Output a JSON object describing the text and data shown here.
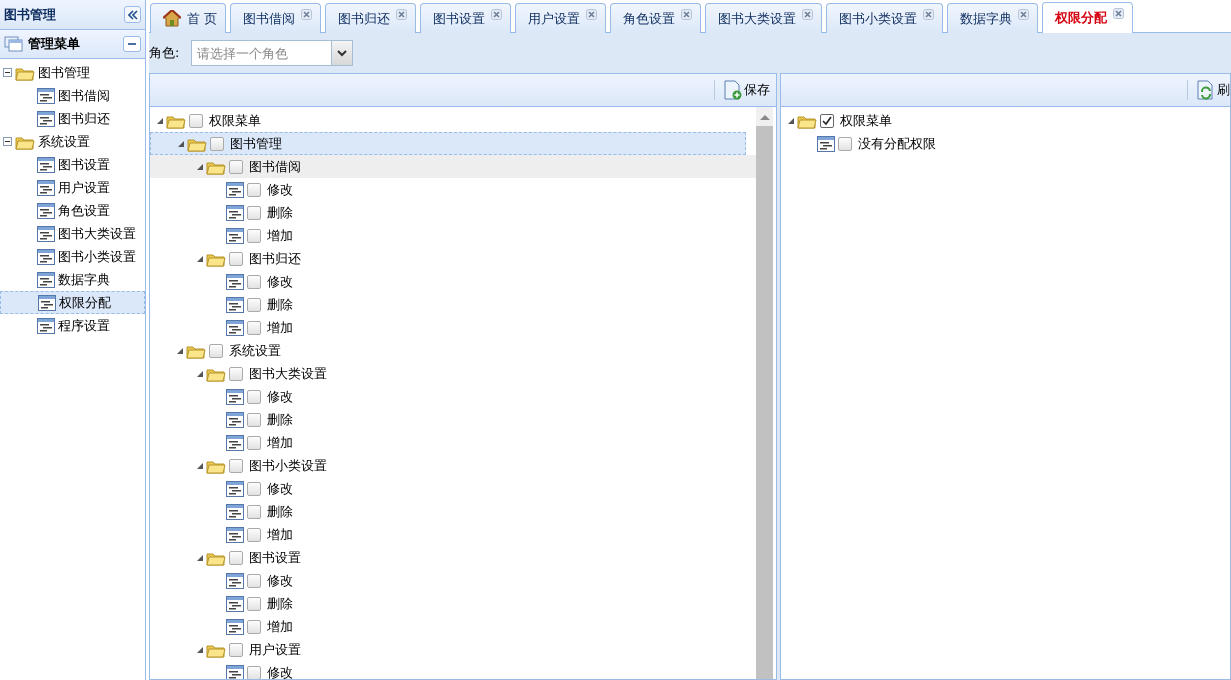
{
  "sidebar": {
    "title": "图书管理",
    "accordion_title": "管理菜单",
    "menu": [
      {
        "label": "图书管理",
        "kind": "folder",
        "expanded": true,
        "children": [
          {
            "label": "图书借阅",
            "kind": "leaf",
            "selected": false
          },
          {
            "label": "图书归还",
            "kind": "leaf",
            "selected": false
          }
        ]
      },
      {
        "label": "系统设置",
        "kind": "folder",
        "expanded": true,
        "children": [
          {
            "label": "图书设置",
            "kind": "leaf",
            "selected": false
          },
          {
            "label": "用户设置",
            "kind": "leaf",
            "selected": false
          },
          {
            "label": "角色设置",
            "kind": "leaf",
            "selected": false
          },
          {
            "label": "图书大类设置",
            "kind": "leaf",
            "selected": false
          },
          {
            "label": "图书小类设置",
            "kind": "leaf",
            "selected": false
          },
          {
            "label": "数据字典",
            "kind": "leaf",
            "selected": false
          },
          {
            "label": "权限分配",
            "kind": "leaf",
            "selected": true
          },
          {
            "label": "程序设置",
            "kind": "leaf",
            "selected": false
          }
        ]
      }
    ]
  },
  "tabs": [
    {
      "label": "首 页",
      "kind": "home",
      "selected": false
    },
    {
      "label": "图书借阅",
      "kind": "page",
      "selected": false
    },
    {
      "label": "图书归还",
      "kind": "page",
      "selected": false
    },
    {
      "label": "图书设置",
      "kind": "page",
      "selected": false
    },
    {
      "label": "用户设置",
      "kind": "page",
      "selected": false
    },
    {
      "label": "角色设置",
      "kind": "page",
      "selected": false
    },
    {
      "label": "图书大类设置",
      "kind": "page",
      "selected": false
    },
    {
      "label": "图书小类设置",
      "kind": "page",
      "selected": false
    },
    {
      "label": "数据字典",
      "kind": "page",
      "selected": false
    },
    {
      "label": "权限分配",
      "kind": "page",
      "selected": true
    }
  ],
  "role_filter": {
    "label": "角色:",
    "placeholder": "请选择一个角色"
  },
  "left_panel": {
    "button": "保存",
    "tree": [
      {
        "label": "权限菜单",
        "kind": "folder",
        "checked": false,
        "selected": false,
        "hovered": false,
        "children": [
          {
            "label": "图书管理",
            "kind": "folder",
            "checked": false,
            "selected": true,
            "hovered": false,
            "children": [
              {
                "label": "图书借阅",
                "kind": "folder",
                "checked": false,
                "selected": false,
                "hovered": true,
                "children": [
                  {
                    "label": "修改",
                    "kind": "leaf",
                    "checked": false,
                    "selected": false,
                    "hovered": false
                  },
                  {
                    "label": "删除",
                    "kind": "leaf",
                    "checked": false,
                    "selected": false,
                    "hovered": false
                  },
                  {
                    "label": "增加",
                    "kind": "leaf",
                    "checked": false,
                    "selected": false,
                    "hovered": false
                  }
                ]
              },
              {
                "label": "图书归还",
                "kind": "folder",
                "checked": false,
                "selected": false,
                "hovered": false,
                "children": [
                  {
                    "label": "修改",
                    "kind": "leaf",
                    "checked": false,
                    "selected": false,
                    "hovered": false
                  },
                  {
                    "label": "删除",
                    "kind": "leaf",
                    "checked": false,
                    "selected": false,
                    "hovered": false
                  },
                  {
                    "label": "增加",
                    "kind": "leaf",
                    "checked": false,
                    "selected": false,
                    "hovered": false
                  }
                ]
              }
            ]
          },
          {
            "label": "系统设置",
            "kind": "folder",
            "checked": false,
            "selected": false,
            "hovered": false,
            "children": [
              {
                "label": "图书大类设置",
                "kind": "folder",
                "checked": false,
                "selected": false,
                "hovered": false,
                "children": [
                  {
                    "label": "修改",
                    "kind": "leaf",
                    "checked": false,
                    "selected": false,
                    "hovered": false
                  },
                  {
                    "label": "删除",
                    "kind": "leaf",
                    "checked": false,
                    "selected": false,
                    "hovered": false
                  },
                  {
                    "label": "增加",
                    "kind": "leaf",
                    "checked": false,
                    "selected": false,
                    "hovered": false
                  }
                ]
              },
              {
                "label": "图书小类设置",
                "kind": "folder",
                "checked": false,
                "selected": false,
                "hovered": false,
                "children": [
                  {
                    "label": "修改",
                    "kind": "leaf",
                    "checked": false,
                    "selected": false,
                    "hovered": false
                  },
                  {
                    "label": "删除",
                    "kind": "leaf",
                    "checked": false,
                    "selected": false,
                    "hovered": false
                  },
                  {
                    "label": "增加",
                    "kind": "leaf",
                    "checked": false,
                    "selected": false,
                    "hovered": false
                  }
                ]
              },
              {
                "label": "图书设置",
                "kind": "folder",
                "checked": false,
                "selected": false,
                "hovered": false,
                "children": [
                  {
                    "label": "修改",
                    "kind": "leaf",
                    "checked": false,
                    "selected": false,
                    "hovered": false
                  },
                  {
                    "label": "删除",
                    "kind": "leaf",
                    "checked": false,
                    "selected": false,
                    "hovered": false
                  },
                  {
                    "label": "增加",
                    "kind": "leaf",
                    "checked": false,
                    "selected": false,
                    "hovered": false
                  }
                ]
              },
              {
                "label": "用户设置",
                "kind": "folder",
                "checked": false,
                "selected": false,
                "hovered": false,
                "children": [
                  {
                    "label": "修改",
                    "kind": "leaf",
                    "checked": false,
                    "selected": false,
                    "hovered": false
                  }
                ]
              }
            ]
          }
        ]
      }
    ]
  },
  "right_panel": {
    "button": "刷",
    "tree": [
      {
        "label": "权限菜单",
        "kind": "folder",
        "checked": true,
        "selected": false,
        "hovered": false,
        "children": [
          {
            "label": "没有分配权限",
            "kind": "leaf",
            "checked": false,
            "selected": false,
            "hovered": false
          }
        ]
      }
    ]
  }
}
